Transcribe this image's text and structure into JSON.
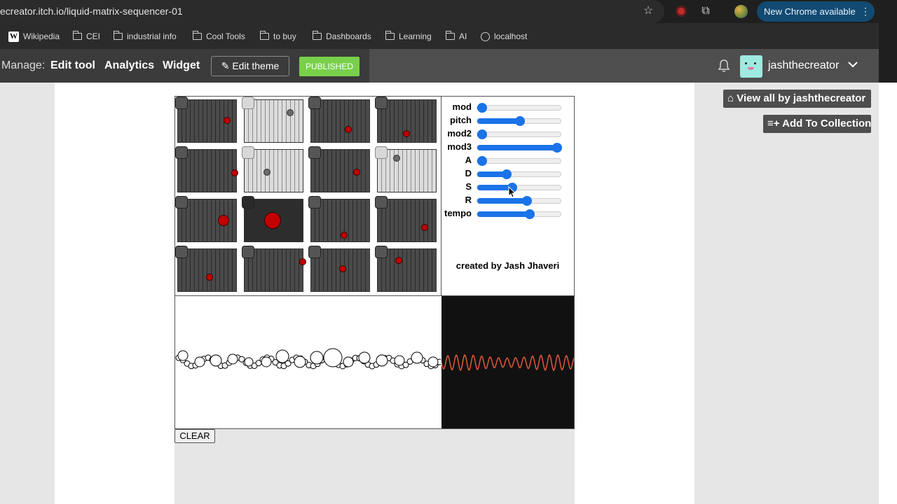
{
  "browser": {
    "url": "ecreator.itch.io/liquid-matrix-sequencer-01",
    "update_label": "New Chrome available",
    "bookmarks": [
      {
        "label": "Wikipedia",
        "icon": "wikipedia-icon"
      },
      {
        "label": "CEI",
        "icon": "folder-icon"
      },
      {
        "label": "industrial info",
        "icon": "folder-icon"
      },
      {
        "label": "Cool Tools",
        "icon": "folder-icon"
      },
      {
        "label": "to buy",
        "icon": "folder-icon"
      },
      {
        "label": "Dashboards",
        "icon": "folder-icon"
      },
      {
        "label": "Learning",
        "icon": "folder-icon"
      },
      {
        "label": "AI",
        "icon": "folder-icon"
      },
      {
        "label": "localhost",
        "icon": "globe-icon"
      }
    ]
  },
  "manage_bar": {
    "manage_label": "Manage:",
    "edit_tool": "Edit tool",
    "analytics": "Analytics",
    "widget": "Widget",
    "edit_theme": "Edit theme",
    "published": "PUBLISHED",
    "username": "jashthecreator"
  },
  "side": {
    "view_all": "View all by jashthecreator",
    "add_collection": "Add To Collection"
  },
  "game": {
    "sliders": [
      {
        "label": "mod",
        "value": 0.0
      },
      {
        "label": "pitch",
        "value": 0.5
      },
      {
        "label": "mod2",
        "value": 0.0
      },
      {
        "label": "mod3",
        "value": 1.0
      },
      {
        "label": "A",
        "value": 0.0
      },
      {
        "label": "D",
        "value": 0.33
      },
      {
        "label": "S",
        "value": 0.4
      },
      {
        "label": "R",
        "value": 0.6
      },
      {
        "label": "tempo",
        "value": 0.64
      }
    ],
    "credit": "created by Jash Jhaveri",
    "clear_label": "CLEAR",
    "cells": [
      {
        "style": "dark",
        "dot": "red",
        "active": false
      },
      {
        "style": "light",
        "dot": "gray",
        "active": false
      },
      {
        "style": "dark",
        "dot": "red",
        "active": false
      },
      {
        "style": "dark",
        "dot": "red",
        "active": false
      },
      {
        "style": "dark",
        "dot": "red",
        "active": false
      },
      {
        "style": "light",
        "dot": "gray",
        "active": false
      },
      {
        "style": "dark",
        "dot": "red",
        "active": false
      },
      {
        "style": "light",
        "dot": "gray",
        "active": false
      },
      {
        "style": "dark",
        "dot": "red",
        "active": false
      },
      {
        "style": "dark",
        "dot": "red",
        "active": true
      },
      {
        "style": "dark",
        "dot": "red",
        "active": false
      },
      {
        "style": "dark",
        "dot": "red",
        "active": false
      },
      {
        "style": "dark",
        "dot": "red",
        "active": false
      },
      {
        "style": "dark",
        "dot": "red",
        "active": false
      },
      {
        "style": "dark",
        "dot": "red",
        "active": false
      },
      {
        "style": "dark",
        "dot": "red",
        "active": false
      }
    ]
  },
  "colors": {
    "published_green": "#79d04a",
    "slider_blue": "#1a73e8",
    "wave": "#e0593e",
    "dot_red": "#c20000"
  }
}
